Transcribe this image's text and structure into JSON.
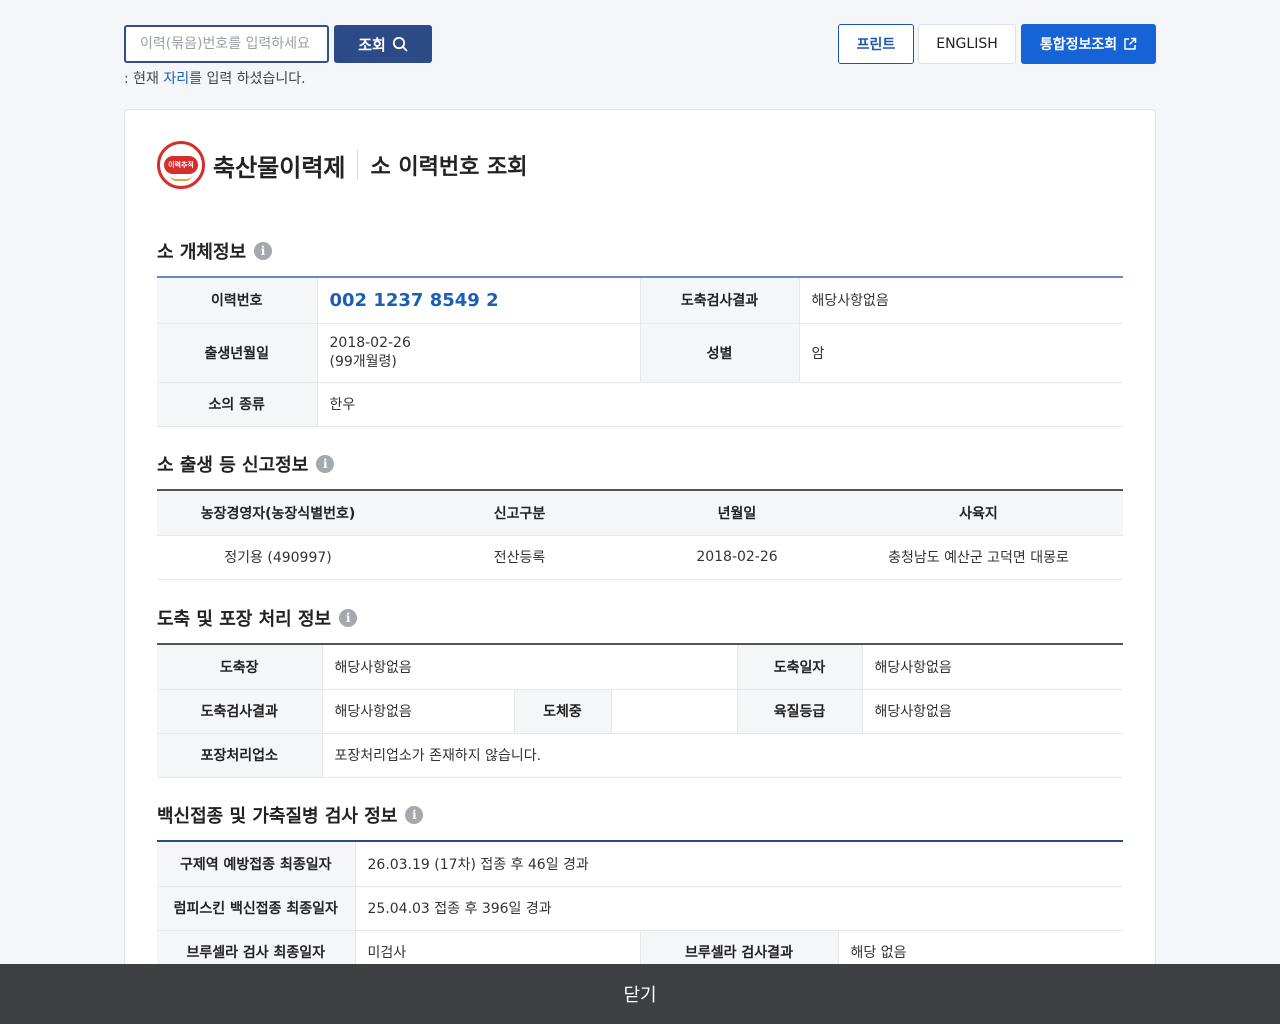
{
  "search": {
    "placeholder": "이력(묶음)번호를 입력하세요",
    "button_label": "조회",
    "hint_prefix": ": 현재 ",
    "hint_highlight": "자리",
    "hint_suffix": "를 입력 하셨습니다."
  },
  "toolbar": {
    "print_label": "프린트",
    "english_label": "ENGLISH",
    "integrated_label": "통합정보조회"
  },
  "header": {
    "logo_text": "이력추적",
    "brand": "축산물이력제",
    "title": "소 이력번호 조회"
  },
  "section_cattle": {
    "title": "소 개체정보",
    "trace_label": "이력번호",
    "trace_value": "002 1237 8549 2",
    "inspect_label": "도축검사결과",
    "inspect_value": "해당사항없음",
    "birth_label": "출생년월일",
    "birth_date": "2018-02-26",
    "birth_age": "(99개월령)",
    "sex_label": "성별",
    "sex_value": "암",
    "type_label": "소의 종류",
    "type_value": "한우"
  },
  "section_report": {
    "title": "소 출생 등 신고정보",
    "headers": [
      "농장경영자(농장식별번호)",
      "신고구분",
      "년월일",
      "사육지"
    ],
    "row": [
      "정기용 (490997)",
      "전산등록",
      "2018-02-26",
      "충청남도 예산군 고덕면 대몽로"
    ]
  },
  "section_slaughter": {
    "title": "도축 및 포장 처리 정보",
    "plant_label": "도축장",
    "plant_value": "해당사항없음",
    "date_label": "도축일자",
    "date_value": "해당사항없음",
    "inspect_label": "도축검사결과",
    "inspect_value": "해당사항없음",
    "weight_label": "도체중",
    "weight_value": "",
    "grade_label": "육질등급",
    "grade_value": "해당사항없음",
    "pack_label": "포장처리업소",
    "pack_value": "포장처리업소가 존재하지 않습니다."
  },
  "section_vaccine": {
    "title": "백신접종 및 가축질병 검사 정보",
    "fmd_label": "구제역 예방접종 최종일자",
    "fmd_value": "26.03.19 (17차) 접종 후 46일 경과",
    "lumpy_label": "럼피스킨 백신접종 최종일자",
    "lumpy_value": "25.04.03 접종 후 396일 경과",
    "brucella_date_label": "브루셀라 검사 최종일자",
    "brucella_date_value": "미검사",
    "brucella_result_label": "브루셀라 검사결과",
    "brucella_result_value": "해당 없음"
  },
  "footer": {
    "close_label": "닫기"
  }
}
